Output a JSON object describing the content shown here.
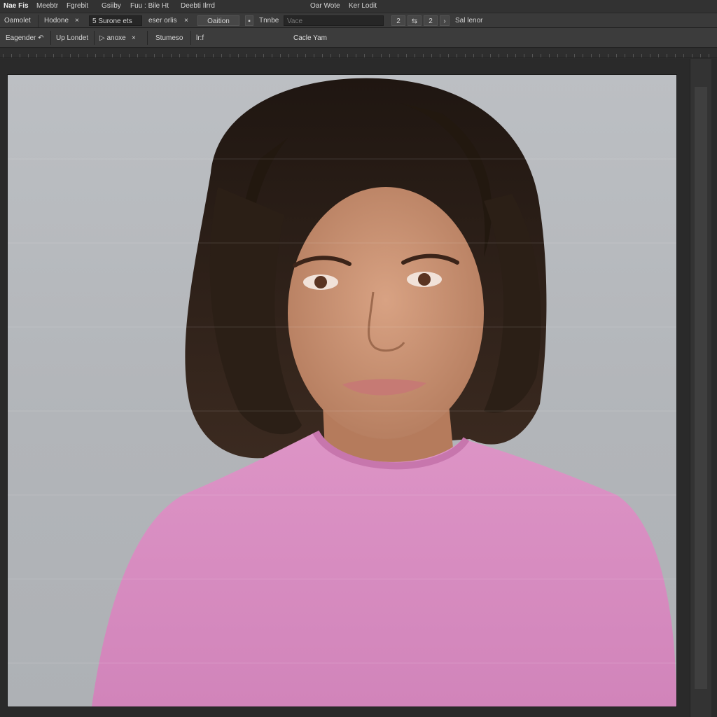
{
  "menu": {
    "items": [
      "Nae Fis",
      "Meebtr",
      "Fgrebit",
      "Gsiiby",
      "Fuu : Bile Ht",
      "Deebti Ilrrd",
      "Oar Wote",
      "Ker Lodit"
    ]
  },
  "options": {
    "preset": "Oamolet",
    "mode": "Hodone",
    "mode_close": "×",
    "layer_field": "Surone ets",
    "layer_field_prefix": "5",
    "blend": "eser orlis",
    "blend_close": "×",
    "option_btn": "Oaition",
    "tone_label": "Tnnbe",
    "value_field_placeholder": "Vace",
    "value_field_value": "",
    "nav_buttons": [
      "2",
      "⇆",
      "2",
      "›"
    ],
    "right_label": "Sal lenor"
  },
  "tabs": {
    "items": [
      "Eagender ↶",
      "Up Londet",
      "▷ anoxe",
      "×",
      "Stumeso",
      "lr:f"
    ],
    "document_title": "Cacle Yam"
  },
  "document": {
    "image_description_hidden": "",
    "colors": {
      "background": "#b4b7bb",
      "hair": "#2d1f18",
      "skin": "#c68e6e",
      "shirt": "#d98cc0"
    }
  }
}
